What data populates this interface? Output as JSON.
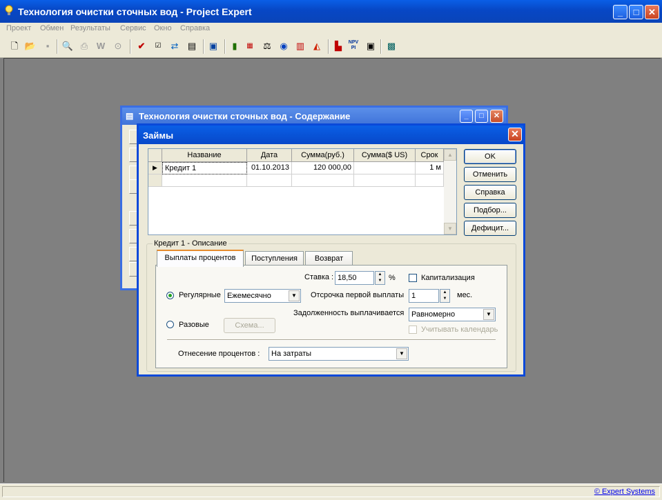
{
  "app": {
    "title": "Технология очистки сточных вод - Project Expert"
  },
  "menu": [
    "Проект",
    "Обмен",
    "Результаты",
    "Сервис",
    "Окно",
    "Справка"
  ],
  "toolbar_icons": [
    "new-file-icon",
    "open-folder-icon",
    "save-icon",
    "print-preview-icon",
    "print-icon",
    "word-export-icon",
    "search-icon",
    "checkmark-icon",
    "check-icon",
    "transfer-icon",
    "notes-icon",
    "screen-icon",
    "bookmark-icon",
    "cashflow-icon",
    "balance-icon",
    "calculator-icon",
    "report-icon",
    "chart-icon",
    "npv-chart-icon",
    "npv-pi-icon",
    "table-icon",
    "analysis-icon"
  ],
  "status": {
    "link": "© Expert Systems"
  },
  "contents_window": {
    "title": "Технология очистки сточных вод - Содержание"
  },
  "dialog": {
    "title": "Займы",
    "grid": {
      "columns": [
        "Название",
        "Дата",
        "Сумма(руб.)",
        "Сумма($ US)",
        "Срок"
      ],
      "rows": [
        {
          "name": "Кредит 1",
          "date": "01.10.2013",
          "sum_rub": "120 000,00",
          "sum_usd": "",
          "term": "1 м"
        }
      ]
    },
    "buttons": {
      "ok": "OK",
      "cancel": "Отменить",
      "help": "Справка",
      "select": "Подбор...",
      "deficit": "Дефицит..."
    },
    "description": {
      "legend": "Кредит 1 - Описание",
      "tabs": [
        "Выплаты процентов",
        "Поступления",
        "Возврат"
      ],
      "rate_label": "Ставка :",
      "rate_value": "18,50",
      "rate_unit": "%",
      "capitalization_label": "Капитализация",
      "regular_label": "Регулярные",
      "regular_value": "Ежемесячно",
      "deferral_label": "Отсрочка первой выплаты",
      "deferral_value": "1",
      "deferral_unit": "мес.",
      "debt_label": "Задолженность выплачивается",
      "debt_value": "Равномерно",
      "calendar_label": "Учитывать календарь",
      "onetime_label": "Разовые",
      "scheme_button": "Схема...",
      "attribution_label": "Отнесение процентов :",
      "attribution_value": "На затраты"
    }
  }
}
